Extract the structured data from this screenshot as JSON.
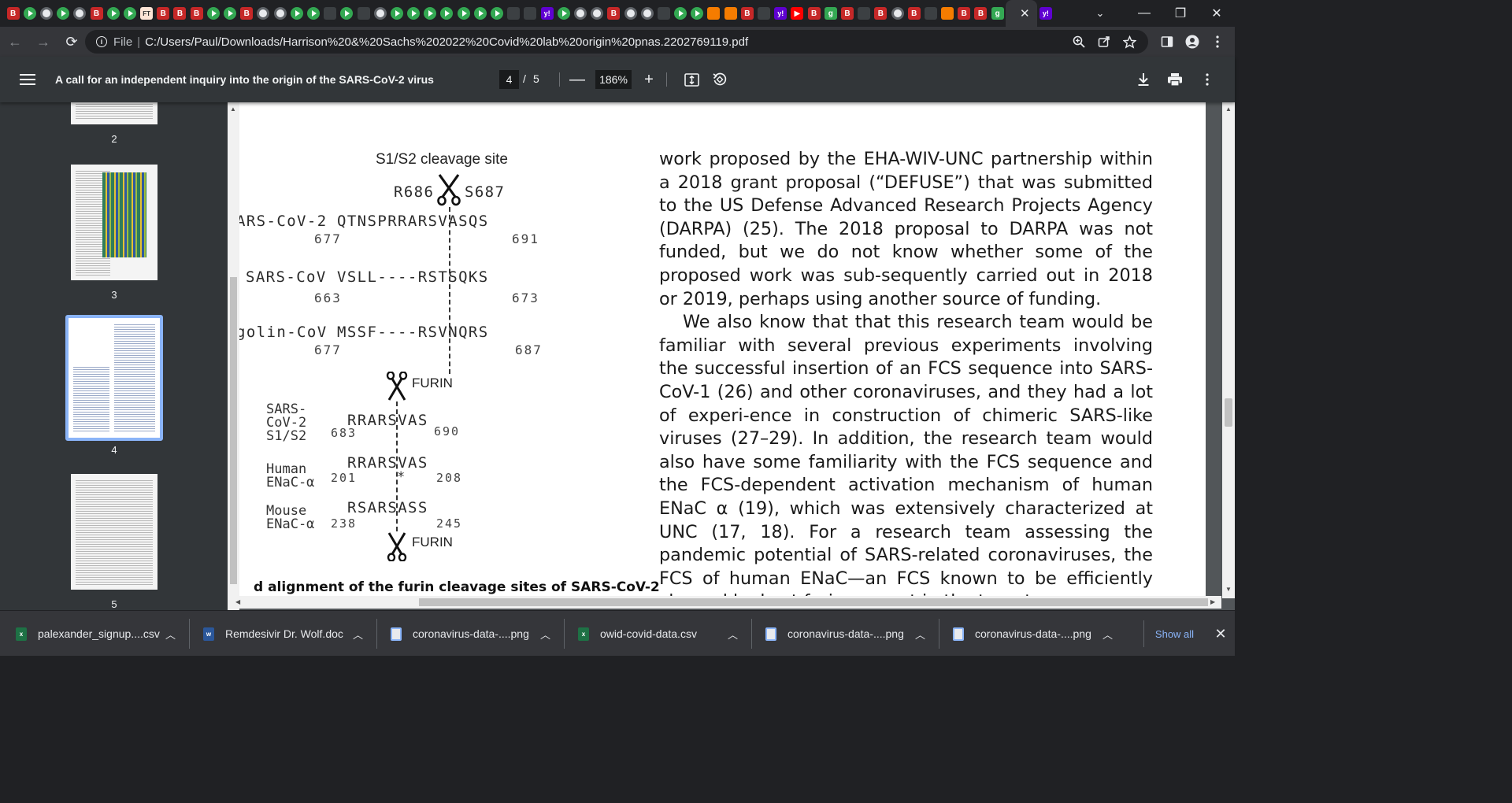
{
  "browser": {
    "tab_favicons": [
      "bi",
      "play",
      "circ",
      "play",
      "circ",
      "bi",
      "play",
      "play",
      "ft",
      "bi",
      "bi",
      "bi",
      "play",
      "play",
      "bi",
      "circ",
      "circ",
      "play",
      "play",
      "dark",
      "play",
      "dark",
      "circ",
      "play",
      "play",
      "play",
      "play",
      "play",
      "play",
      "play",
      "dark",
      "dark",
      "yahoo",
      "play",
      "circ",
      "circ",
      "bi",
      "circ",
      "circ",
      "dark",
      "play",
      "play",
      "orange",
      "orange",
      "bi",
      "dark",
      "yahoo",
      "yt",
      "bi",
      "green",
      "bi",
      "dark",
      "bi",
      "circ",
      "bi",
      "dark",
      "orange",
      "bi",
      "bi",
      "green"
    ],
    "active_tab_close": "✕",
    "new_tab": "+",
    "window": {
      "tab_search": "⌄",
      "minimize": "—",
      "restore": "❐",
      "close": "✕"
    },
    "nav": {
      "back": "←",
      "forward": "→",
      "reload": "⟳"
    },
    "address": {
      "scheme_label": "File",
      "separator": "|",
      "url": "C:/Users/Paul/Downloads/Harrison%20&%20Sachs%202022%20Covid%20lab%20origin%20pnas.2202769119.pdf"
    }
  },
  "pdf_toolbar": {
    "title": "A call for an independent inquiry into the origin of the SARS-CoV-2 virus",
    "current_page": "4",
    "page_separator": "/",
    "total_pages": "5",
    "zoom_out": "—",
    "zoom_level": "186%",
    "zoom_in": "+"
  },
  "sidebar": {
    "thumbnails": [
      {
        "number": "2"
      },
      {
        "number": "3"
      },
      {
        "number": "4",
        "selected": true
      },
      {
        "number": "5"
      }
    ]
  },
  "figure": {
    "heading": "S1/S2 cleavage site",
    "left_residue": "R686",
    "right_residue": "S687",
    "rows": [
      {
        "name": "ARS-CoV-2",
        "seq": "QTNSPRRARSVASQS",
        "start": "677",
        "end": "691"
      },
      {
        "name": "SARS-CoV",
        "seq": "VSLL----RSTSQKS",
        "start": "663",
        "end": "673"
      },
      {
        "name": "golin-CoV",
        "seq": "MSSF----RSVNQRS",
        "start": "677",
        "end": "687"
      }
    ],
    "furin_label_top": "FURIN",
    "furin_label_bottom": "FURIN",
    "furin_rows": [
      {
        "label": [
          "SARS-",
          "CoV-2",
          "S1/S2"
        ],
        "seq": "RRARSVAS",
        "start": "683",
        "end": "690",
        "mark": ""
      },
      {
        "label": [
          "Human",
          "ENaC-α"
        ],
        "seq": "RRARSVAS",
        "start": "201",
        "end": "208",
        "mark": "*"
      },
      {
        "label": [
          "Mouse",
          "ENaC-α"
        ],
        "seq": "RSARSASS",
        "start": "238",
        "end": "245",
        "mark": ""
      }
    ],
    "caption": "d alignment of the furin cleavage sites of SARS-CoV-2"
  },
  "body": {
    "paragraph1": "work proposed by the EHA-WIV-UNC partnership within a 2018 grant proposal (“DEFUSE”) that was submitted to the US Defense Advanced Research Projects Agency (DARPA) (25). The 2018 proposal to DARPA was not funded, but we do not know whether some of the proposed work was sub-sequently carried out in 2018 or 2019, perhaps using another source of funding.",
    "paragraph2": "We also know that that this research team would be familiar with several previous experiments involving the successful insertion of an FCS sequence into SARS-CoV-1 (26) and other coronaviruses, and they had a lot of experi-ence in construction of chimeric SARS-like viruses (27–29). In addition, the research team would also have some familiarity with the FCS sequence and the FCS-dependent activation mechanism of human ENaC α (19), which was extensively characterized at UNC (17, 18). For a research team assessing the pandemic potential of SARS-related coronaviruses, the FCS of human ENaC—an FCS known to be efficiently cleaved by host furin present in the target"
  },
  "downloads": {
    "items": [
      {
        "name": "palexander_signup....csv",
        "type": "xls"
      },
      {
        "name": "Remdesivir Dr. Wolf.doc",
        "type": "doc"
      },
      {
        "name": "coronavirus-data-....png",
        "type": "png"
      },
      {
        "name": "owid-covid-data.csv",
        "type": "xls"
      },
      {
        "name": "coronavirus-data-....png",
        "type": "png"
      },
      {
        "name": "coronavirus-data-....png",
        "type": "png"
      }
    ],
    "show_all": "Show all",
    "close": "✕"
  },
  "colors": {
    "tab_strip": "#202124",
    "toolbar": "#35363a",
    "pdf_toolbar": "#323639",
    "viewer_bg": "#525659",
    "accent": "#8ab4f8"
  }
}
